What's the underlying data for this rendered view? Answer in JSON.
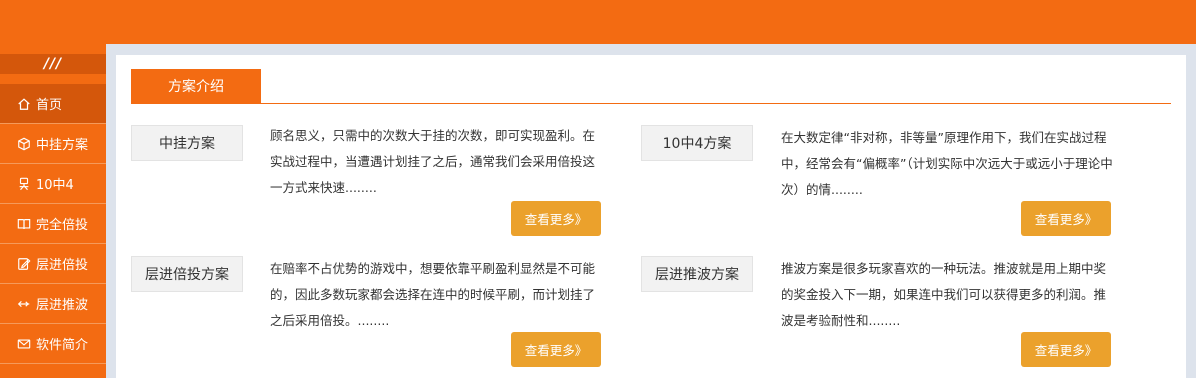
{
  "sidebar": {
    "toggle_label": "///",
    "items": [
      {
        "label": "首页",
        "icon": "home-icon"
      },
      {
        "label": "中挂方案",
        "icon": "cube-icon"
      },
      {
        "label": "10中4",
        "icon": "person-icon"
      },
      {
        "label": "完全倍投",
        "icon": "book-icon"
      },
      {
        "label": "层进倍投",
        "icon": "edit-icon"
      },
      {
        "label": "层进推波",
        "icon": "arrows-icon"
      },
      {
        "label": "软件简介",
        "icon": "mail-icon"
      }
    ]
  },
  "main": {
    "section_title": "方案介绍",
    "plans": [
      {
        "label": "中挂方案",
        "description": "顾名思义，只需中的次数大于挂的次数，即可实现盈利。在实战过程中，当遭遇计划挂了之后，通常我们会采用倍投这一方式来快速........",
        "button": "查看更多》"
      },
      {
        "label": "10中4方案",
        "description": "在大数定律“非对称，非等量”原理作用下，我们在实战过程中，经常会有“偏概率”（计划实际中次远大于或远小于理论中次）的情........",
        "button": "查看更多》"
      },
      {
        "label": "层进倍投方案",
        "description": "在赔率不占优势的游戏中，想要依靠平刷盈利显然是不可能的，因此多数玩家都会选择在连中的时候平刷，而计划挂了之后采用倍投。........",
        "button": "查看更多》"
      },
      {
        "label": "层进推波方案",
        "description": "推波方案是很多玩家喜欢的一种玩法。推波就是用上期中奖的奖金投入下一期，如果连中我们可以获得更多的利润。推波是考验耐性和........",
        "button": "查看更多》"
      }
    ]
  }
}
